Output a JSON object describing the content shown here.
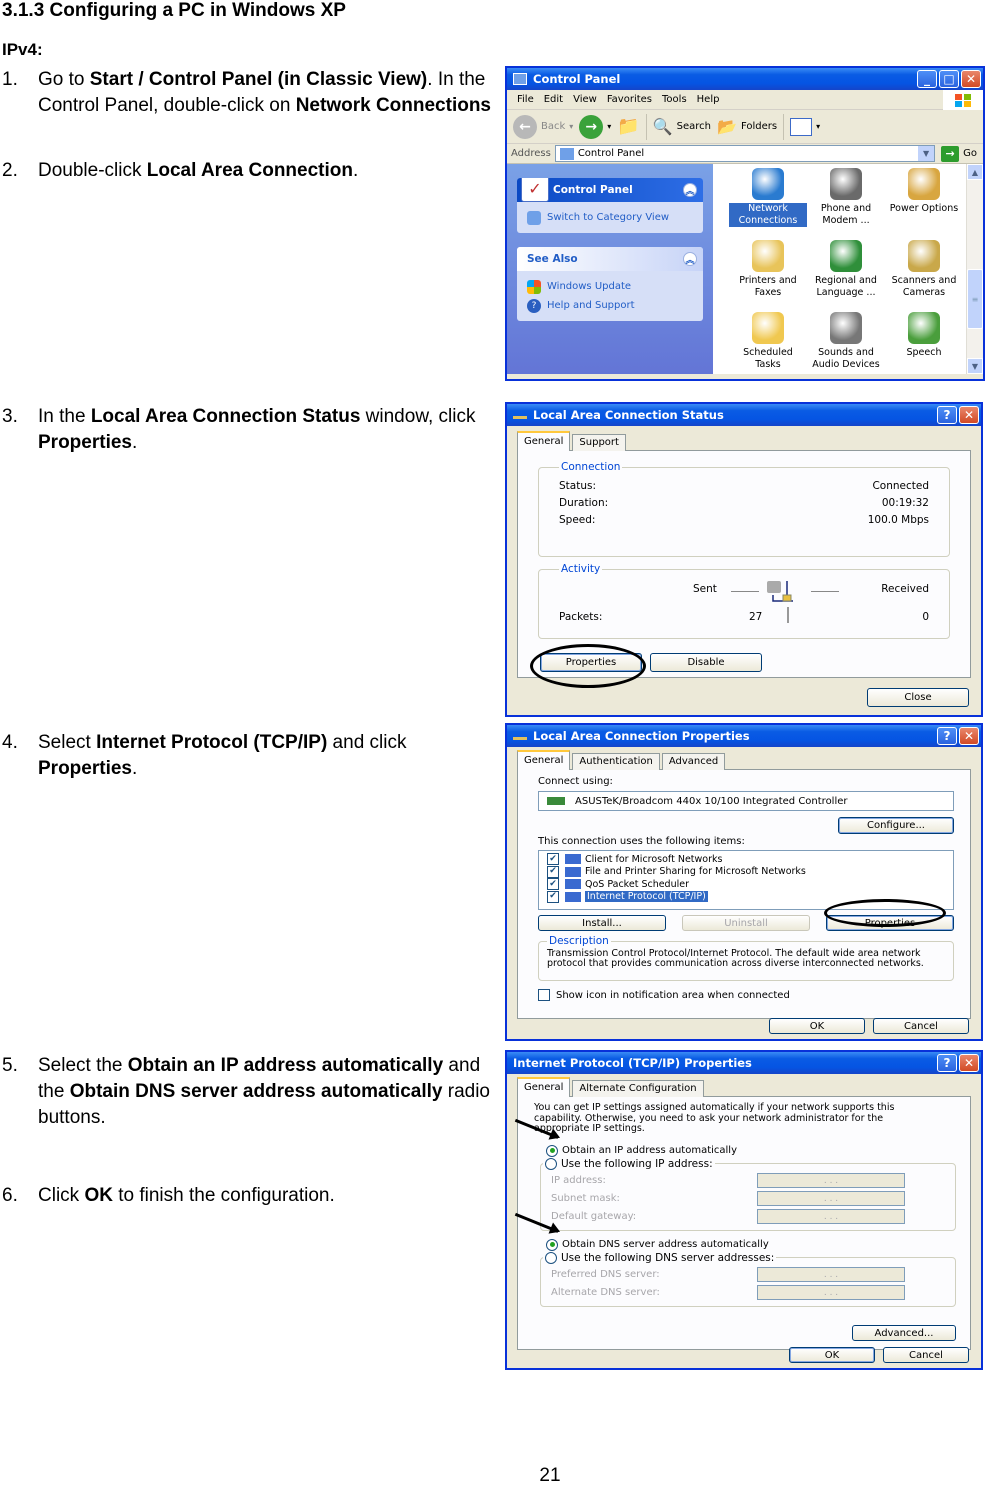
{
  "heading": "3.1.3 Configuring a PC in Windows XP",
  "subheading": "IPv4:",
  "steps": [
    {
      "num": "1.",
      "parts": [
        {
          "t": "Go to ",
          "b": false
        },
        {
          "t": "Start / Control Panel (in Classic View)",
          "b": true
        },
        {
          "t": ". In the Control Panel, double-click on ",
          "b": false
        },
        {
          "t": "Network Connections",
          "b": true
        }
      ]
    },
    {
      "num": "2.",
      "parts": [
        {
          "t": "Double-click ",
          "b": false
        },
        {
          "t": "Local Area Connection",
          "b": true
        },
        {
          "t": ".",
          "b": false
        }
      ]
    },
    {
      "num": "3.",
      "parts": [
        {
          "t": "In the ",
          "b": false
        },
        {
          "t": "Local Area Connection Status",
          "b": true
        },
        {
          "t": " window, click ",
          "b": false
        },
        {
          "t": "Properties",
          "b": true
        },
        {
          "t": ".",
          "b": false
        }
      ]
    },
    {
      "num": "4.",
      "parts": [
        {
          "t": "Select ",
          "b": false
        },
        {
          "t": "Internet Protocol (TCP/IP)",
          "b": true
        },
        {
          "t": " and click ",
          "b": false
        },
        {
          "t": "Properties",
          "b": true
        },
        {
          "t": ".",
          "b": false
        }
      ]
    },
    {
      "num": "5.",
      "parts": [
        {
          "t": "Select the ",
          "b": false
        },
        {
          "t": "Obtain an IP address automatically",
          "b": true
        },
        {
          "t": " and the ",
          "b": false
        },
        {
          "t": "Obtain DNS server address automatically",
          "b": true
        },
        {
          "t": " radio buttons.",
          "b": false
        }
      ]
    },
    {
      "num": "6.",
      "parts": [
        {
          "t": "Click ",
          "b": false
        },
        {
          "t": "OK",
          "b": true
        },
        {
          "t": " to finish the configuration.",
          "b": false
        }
      ]
    }
  ],
  "page_number": "21",
  "control_panel": {
    "title": "Control Panel",
    "menu": [
      "File",
      "Edit",
      "View",
      "Favorites",
      "Tools",
      "Help"
    ],
    "toolbar": {
      "back": "Back",
      "search": "Search",
      "folders": "Folders"
    },
    "address_label": "Address",
    "address_value": "Control Panel",
    "go_label": "Go",
    "task_panel": {
      "title": "Control Panel",
      "link": "Switch to Category View"
    },
    "see_also": {
      "title": "See Also",
      "links": [
        "Windows Update",
        "Help and Support"
      ]
    },
    "items": [
      {
        "label": "Network Connections",
        "selected": true,
        "color": "#2a7bd0"
      },
      {
        "label": "Phone and Modem ...",
        "selected": false,
        "color": "#6a6a6a"
      },
      {
        "label": "Power Options",
        "selected": false,
        "color": "#d8a640"
      },
      {
        "label": "Printers and Faxes",
        "selected": false,
        "color": "#e8c45a"
      },
      {
        "label": "Regional and Language ...",
        "selected": false,
        "color": "#2f8f3a"
      },
      {
        "label": "Scanners and Cameras",
        "selected": false,
        "color": "#c9a84a"
      },
      {
        "label": "Scheduled Tasks",
        "selected": false,
        "color": "#f0c850"
      },
      {
        "label": "Sounds and Audio Devices",
        "selected": false,
        "color": "#777777"
      },
      {
        "label": "Speech",
        "selected": false,
        "color": "#4a9e3c"
      }
    ]
  },
  "status_dialog": {
    "title": "Local Area Connection Status",
    "tabs": [
      "General",
      "Support"
    ],
    "connection_legend": "Connection",
    "rows": [
      {
        "label": "Status:",
        "value": "Connected"
      },
      {
        "label": "Duration:",
        "value": "00:19:32"
      },
      {
        "label": "Speed:",
        "value": "100.0 Mbps"
      }
    ],
    "activity_legend": "Activity",
    "sent_label": "Sent",
    "received_label": "Received",
    "packets_label": "Packets:",
    "packets_sent": "27",
    "packets_received": "0",
    "properties_button": "Properties",
    "disable_button": "Disable",
    "close_button": "Close"
  },
  "properties_dialog": {
    "title": "Local Area Connection Properties",
    "tabs": [
      "General",
      "Authentication",
      "Advanced"
    ],
    "connect_using_label": "Connect using:",
    "adapter": "ASUSTeK/Broadcom 440x 10/100 Integrated Controller",
    "configure_button": "Configure...",
    "items_label": "This connection uses the following items:",
    "items": [
      {
        "label": "Client for Microsoft Networks",
        "checked": true,
        "selected": false
      },
      {
        "label": "File and Printer Sharing for Microsoft Networks",
        "checked": true,
        "selected": false
      },
      {
        "label": "QoS Packet Scheduler",
        "checked": true,
        "selected": false
      },
      {
        "label": "Internet Protocol (TCP/IP)",
        "checked": true,
        "selected": true
      }
    ],
    "install_button": "Install...",
    "uninstall_button": "Uninstall",
    "properties_button": "Properties",
    "description_legend": "Description",
    "description": "Transmission Control Protocol/Internet Protocol. The default wide area network protocol that provides communication across diverse interconnected networks.",
    "show_icon_label": "Show icon in notification area when connected",
    "ok_button": "OK",
    "cancel_button": "Cancel"
  },
  "tcpip_dialog": {
    "title": "Internet Protocol (TCP/IP) Properties",
    "tabs": [
      "General",
      "Alternate Configuration"
    ],
    "intro": "You can get IP settings assigned automatically if your network supports this capability. Otherwise, you need to ask your network administrator for the appropriate IP settings.",
    "obtain_ip": "Obtain an IP address automatically",
    "use_ip": "Use the following IP address:",
    "ip_fields": [
      "IP address:",
      "Subnet mask:",
      "Default gateway:"
    ],
    "obtain_dns": "Obtain DNS server address automatically",
    "use_dns": "Use the following DNS server addresses:",
    "dns_fields": [
      "Preferred DNS server:",
      "Alternate DNS server:"
    ],
    "ip_placeholder": ".       .       .",
    "advanced_button": "Advanced...",
    "ok_button": "OK",
    "cancel_button": "Cancel"
  }
}
